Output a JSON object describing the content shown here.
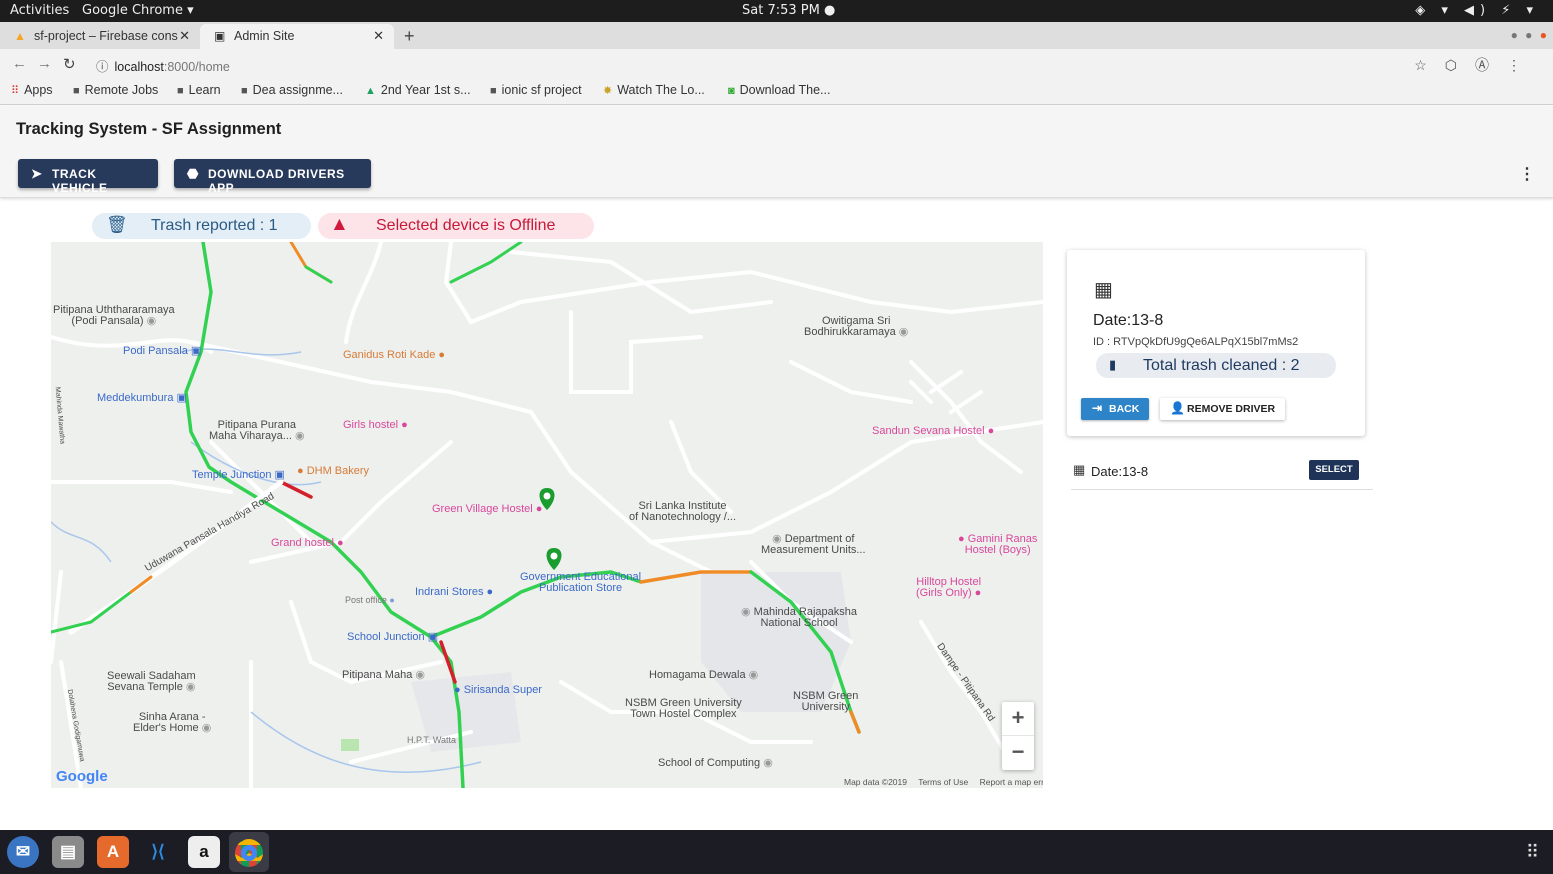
{
  "os": {
    "activities": "Activities",
    "app_name": "Google Chrome ▾",
    "clock": "Sat  7:53 PM ●",
    "tray": "◈ ▾ ◀) ⚡ ▾"
  },
  "browser": {
    "tabs": [
      {
        "title": "sf-project – Firebase cons",
        "favicon": "firebase-icon"
      },
      {
        "title": "Admin Site",
        "favicon": "site-icon"
      }
    ],
    "url_host": "localhost",
    "url_path": ":8000/home",
    "bookmarks": [
      {
        "label": "Apps",
        "icon": "apps-icon"
      },
      {
        "label": "Remote Jobs",
        "icon": "folder-icon"
      },
      {
        "label": "Learn",
        "icon": "folder-icon"
      },
      {
        "label": "Dea assignme...",
        "icon": "folder-icon"
      },
      {
        "label": "2nd Year 1st s...",
        "icon": "drive-icon"
      },
      {
        "label": "ionic sf project",
        "icon": "folder-icon"
      },
      {
        "label": "Watch The Lo...",
        "icon": "star-icon"
      },
      {
        "label": "Download The...",
        "icon": "page-icon"
      }
    ]
  },
  "app": {
    "title": "Tracking System - SF Assignment",
    "track_button": "TRACK VEHICLE",
    "drivers_button": "DOWNLOAD DRIVERS APP",
    "trash_status": "Trash reported : 1",
    "offline_status": "Selected device is Offline"
  },
  "map": {
    "labels": {
      "pitipana_uth": "Pitipana Uththararamaya\n(Podi Pansala)",
      "podi_pansala": "Podi Pansala",
      "meddekumbura": "Meddekumbura",
      "pitipana_purana": "Pitipana Purana\nMaha Viharaya...",
      "temple_junction": "Temple Junction",
      "dhm_bakery": "DHM Bakery",
      "ganidus": "Ganidus Roti Kade",
      "girls_hostel": "Girls hostel",
      "green_village": "Green Village Hostel",
      "grand_hostel": "Grand hostel",
      "uduwana_road": "Uduwana Pansala Handiya Road",
      "post_office": "Post office",
      "indrani": "Indrani Stores",
      "gov_edu": "Government Educational\nPublication Store",
      "sri_lanka_inst": "Sri Lanka Institute\nof Nanotechnology /...",
      "dept_meas": "Department of\nMeasurement Units...",
      "owitigama": "Owitigama Sri\nBodhirukkaramaya",
      "sandun": "Sandun Sevana Hostel",
      "gamini": "Gamini Ranas\nHostel (Boys)",
      "hilltop": "Hilltop Hostel\n(Girls Only)",
      "school_junction": "School Junction",
      "mahinda": "Mahinda Rajapaksha\nNational School",
      "seewali": "Seewali Sadaham\nSevana Temple",
      "pitipana_maha": "Pitipana Maha",
      "sirisanda": "Sirisanda Super",
      "homagama": "Homagama Dewala",
      "nsbm_hostel": "NSBM Green University\nTown Hostel Complex",
      "nsbm": "NSBM Green\nUniversity",
      "sinha": "Sinha Arana -\nElder's Home",
      "hpt_watta": "H.P.T. Watta",
      "school_computing": "School of Computing",
      "dampe_rd": "Dampe - Pitipana Rd",
      "mahinda_mawatha": "Mahinda Mawatha",
      "dolahena": "Dolahena Godigamuwa"
    },
    "zoom_in": "+",
    "zoom_out": "−",
    "google_logo": "Google",
    "map_data": "Map data ©2019",
    "terms": "Terms of Use",
    "report": "Report a map error"
  },
  "detail": {
    "date": "Date:13-8",
    "id": "ID : RTVpQkDfU9gQe6ALPqX15bl7mMs2",
    "total_cleaned": "Total trash cleaned : 2",
    "back_button": "BACK",
    "remove_button": "REMOVE DRIVER"
  },
  "list": {
    "rows": [
      {
        "date": "Date:13-8",
        "select": "SELECT"
      }
    ]
  },
  "colors": {
    "primary_dark": "#283a5b",
    "accent_blue": "#2d84c8",
    "offline_red": "#c7193a",
    "road_green": "#3ddc5a"
  }
}
